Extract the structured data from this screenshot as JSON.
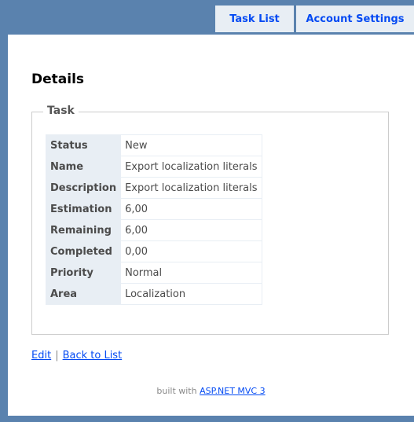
{
  "menu": {
    "items": [
      {
        "label": "Task List"
      },
      {
        "label": "Account Settings"
      }
    ]
  },
  "page": {
    "title": "Details"
  },
  "fieldset": {
    "legend": "Task",
    "rows": [
      {
        "label": "Status",
        "value": "New"
      },
      {
        "label": "Name",
        "value": "Export localization literals"
      },
      {
        "label": "Description",
        "value": "Export localization literals"
      },
      {
        "label": "Estimation",
        "value": "6,00"
      },
      {
        "label": "Remaining",
        "value": "6,00"
      },
      {
        "label": "Completed",
        "value": "0,00"
      },
      {
        "label": "Priority",
        "value": "Normal"
      },
      {
        "label": "Area",
        "value": "Localization"
      }
    ]
  },
  "links": {
    "edit": "Edit",
    "separator": "|",
    "back": "Back to List"
  },
  "footer": {
    "prefix": "built with",
    "link": "ASP.NET MVC 3"
  }
}
